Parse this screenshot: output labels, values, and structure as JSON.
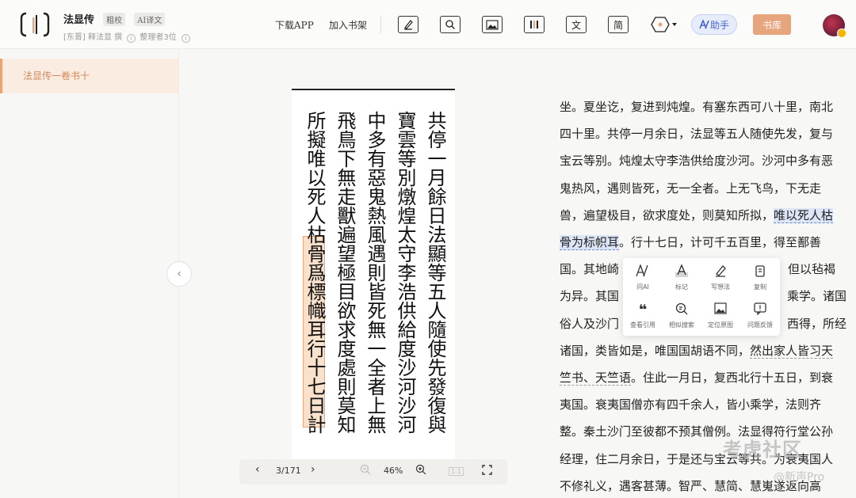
{
  "header": {
    "book_title": "法显传",
    "tag_collate": "粗校",
    "tag_ai": "AI译文",
    "author": "[东晋] 释法显 撰",
    "organizers": "整理者3位",
    "link_download": "下载APP",
    "link_shelf": "加入书架",
    "tool_traditional": "文",
    "tool_simplified": "简",
    "ai_assistant": "助手",
    "library": "书库"
  },
  "sidebar": {
    "chapters": [
      "法显传一卷书十"
    ]
  },
  "scan": {
    "columns": [
      "共停一月餘日法顯等五人隨使先發復與",
      "寶雲等別燉煌太守李浩供給度沙河沙河",
      "中多有惡鬼熱風遇則皆死無一全者上無",
      "飛鳥下無走獸遍望極目欲求度處則莫知",
      "所擬唯以死人枯骨爲標幟耳行十七日計"
    ]
  },
  "viewer": {
    "page": "3/171",
    "zoom": "46%",
    "ratio": "1:1"
  },
  "text": {
    "l1": "坐。夏坐讫，复进到炖煌。有塞东西可八十里，南北",
    "l2": "四十里。共停一月余日，法显等五人随使先发，复与",
    "l3": "宝云等别。炖煌太守李浩供给度沙河。沙河中多有恶",
    "l4": "鬼热风，遇则皆死，无一全者。上无飞鸟，下无走",
    "l5a": "兽，遍望极目，欲求度处，则莫知所拟，",
    "l5b": "唯以死人枯",
    "l6a": "骨为标帜耳",
    "l6b": "。行十七日，计可千五百里，得至鄯善",
    "l7a": "国。其地崎",
    "l7b": "，但以毡褐",
    "l8a": "为异。其国",
    "l8b": "乘学。诸国",
    "l9a": "俗人及沙门",
    "l9b": "西得，所经",
    "l10a": "诸国，类皆如是，唯国国胡语不同，",
    "l10b": "然出家人皆习天",
    "l11a": "竺书、天竺语",
    "l11b": "。住此一月日，复西北行十五日，到衰",
    "l12": "夷国。衰夷国僧亦有四千余人，皆小乘学，法则齐",
    "l13": "整。秦土沙门至彼都不预其僧例。法显得符行堂公孙",
    "l14": "经理，住二月余日，于是还与宝云等共。为衰夷国人",
    "l15": "不修礼义，遇客甚薄。智严、慧简、慧嵬遂返向高"
  },
  "popup": {
    "items": [
      {
        "label": "问AI",
        "icon": "ai-icon"
      },
      {
        "label": "标记",
        "icon": "mark-icon"
      },
      {
        "label": "写想法",
        "icon": "pen-icon"
      },
      {
        "label": "复制",
        "icon": "copy-icon"
      },
      {
        "label": "查看引用",
        "icon": "quote-icon"
      },
      {
        "label": "相似搜索",
        "icon": "similar-search-icon"
      },
      {
        "label": "定位原图",
        "icon": "locate-image-icon"
      },
      {
        "label": "问题反馈",
        "icon": "feedback-icon"
      }
    ]
  },
  "watermark": {
    "line1": "考虎社区",
    "line2": "@新声Pro"
  },
  "colors": {
    "accent": "#e6a57d",
    "ai_blue": "#4a63c9",
    "highlight_orange": "#f6cdaa",
    "highlight_blue": "#dde6f7"
  }
}
